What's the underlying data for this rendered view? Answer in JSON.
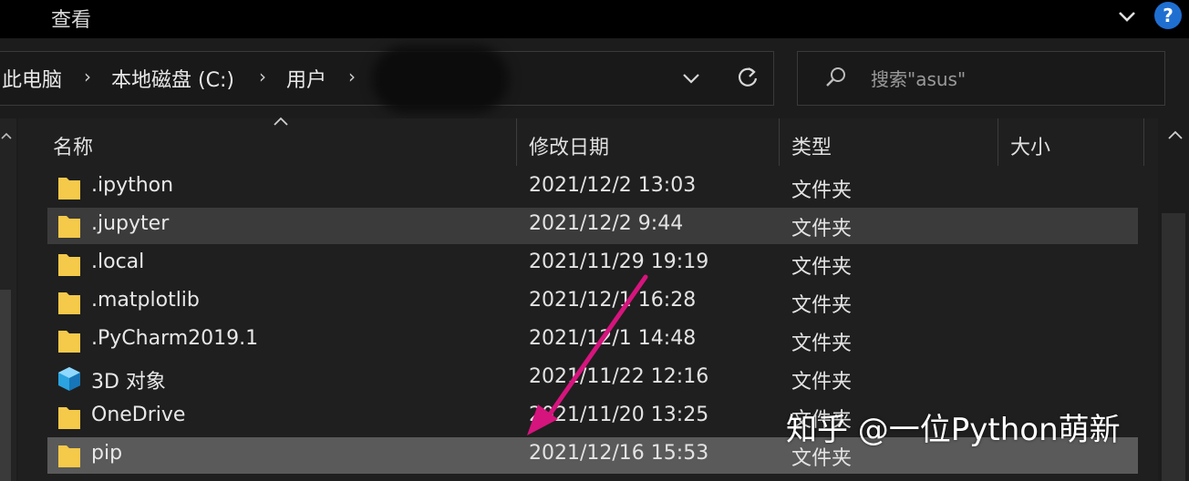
{
  "menu": {
    "view_label": "查看"
  },
  "breadcrumb": {
    "items": [
      "此电脑",
      "本地磁盘 (C:)",
      "用户"
    ],
    "separator": "›"
  },
  "search": {
    "placeholder": "搜索\"asus\""
  },
  "columns": {
    "name": "名称",
    "modified": "修改日期",
    "type": "类型",
    "size": "大小"
  },
  "rows": [
    {
      "name": ".ipython",
      "modified": "2021/12/2 13:03",
      "type": "文件夹",
      "icon": "folder-icon"
    },
    {
      "name": ".jupyter",
      "modified": "2021/12/2 9:44",
      "type": "文件夹",
      "icon": "folder-icon"
    },
    {
      "name": ".local",
      "modified": "2021/11/29 19:19",
      "type": "文件夹",
      "icon": "folder-icon"
    },
    {
      "name": ".matplotlib",
      "modified": "2021/12/1 16:28",
      "type": "文件夹",
      "icon": "folder-icon"
    },
    {
      "name": ".PyCharm2019.1",
      "modified": "2021/12/1 14:48",
      "type": "文件夹",
      "icon": "folder-icon"
    },
    {
      "name": "3D 对象",
      "modified": "2021/11/22 12:16",
      "type": "文件夹",
      "icon": "3d-objects-icon"
    },
    {
      "name": "OneDrive",
      "modified": "2021/11/20 13:25",
      "type": "文件夹",
      "icon": "folder-icon"
    },
    {
      "name": "pip",
      "modified": "2021/12/16 15:53",
      "type": "文件夹",
      "icon": "folder-icon"
    }
  ],
  "colors": {
    "folder": "#f5c94a",
    "arrow": "#d6147d",
    "help": "#1f6fd1",
    "selected_row": "#3b3b3b",
    "highlight_row": "#5a5a5a"
  },
  "watermark": "知乎 @一位Python萌新"
}
